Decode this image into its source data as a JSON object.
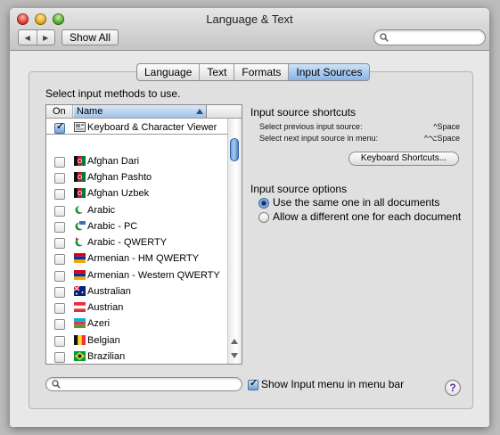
{
  "window": {
    "title": "Language & Text"
  },
  "toolbar": {
    "back": "◀",
    "forward": "▶",
    "show_all": "Show All",
    "search_placeholder": ""
  },
  "tabs": [
    {
      "label": "Language",
      "active": false
    },
    {
      "label": "Text",
      "active": false
    },
    {
      "label": "Formats",
      "active": false
    },
    {
      "label": "Input Sources",
      "active": true
    }
  ],
  "instructions": "Select input methods to use.",
  "list": {
    "col_on": "On",
    "col_name": "Name",
    "rows": [
      {
        "label": "Keyboard & Character Viewer",
        "checked": true,
        "icon": "keyboard-viewer-icon"
      },
      {
        "label": "Afghan Dari",
        "checked": false,
        "icon": "afghanistan-flag-icon"
      },
      {
        "label": "Afghan Pashto",
        "checked": false,
        "icon": "afghanistan-flag-icon"
      },
      {
        "label": "Afghan Uzbek",
        "checked": false,
        "icon": "afghanistan-flag-icon"
      },
      {
        "label": "Arabic",
        "checked": false,
        "icon": "crescent-icon"
      },
      {
        "label": "Arabic - PC",
        "checked": false,
        "icon": "crescent-pc-icon"
      },
      {
        "label": "Arabic - QWERTY",
        "checked": false,
        "icon": "crescent-qwerty-icon"
      },
      {
        "label": "Armenian - HM QWERTY",
        "checked": false,
        "icon": "armenia-flag-icon"
      },
      {
        "label": "Armenian - Western QWERTY",
        "checked": false,
        "icon": "armenia-flag-icon"
      },
      {
        "label": "Australian",
        "checked": false,
        "icon": "australia-flag-icon"
      },
      {
        "label": "Austrian",
        "checked": false,
        "icon": "austria-flag-icon"
      },
      {
        "label": "Azeri",
        "checked": false,
        "icon": "azerbaijan-flag-icon"
      },
      {
        "label": "Belgian",
        "checked": false,
        "icon": "belgium-flag-icon"
      },
      {
        "label": "Brazilian",
        "checked": false,
        "icon": "brazil-flag-icon"
      }
    ]
  },
  "shortcuts": {
    "heading": "Input source shortcuts",
    "prev_label": "Select previous input source:",
    "prev_key": "^Space",
    "next_label": "Select next input source in menu:",
    "next_key": "^⌥Space",
    "button": "Keyboard Shortcuts..."
  },
  "options": {
    "heading": "Input source options",
    "same": "Use the same one in all documents",
    "different": "Allow a different one for each document",
    "selected": "same"
  },
  "bottom": {
    "search_placeholder": "",
    "show_menu_label": "Show Input menu in menu bar",
    "show_menu_checked": true,
    "help": "?"
  },
  "colors": {
    "selection_blue": "#86b4e6",
    "window_bg": "#e8e8e8"
  }
}
